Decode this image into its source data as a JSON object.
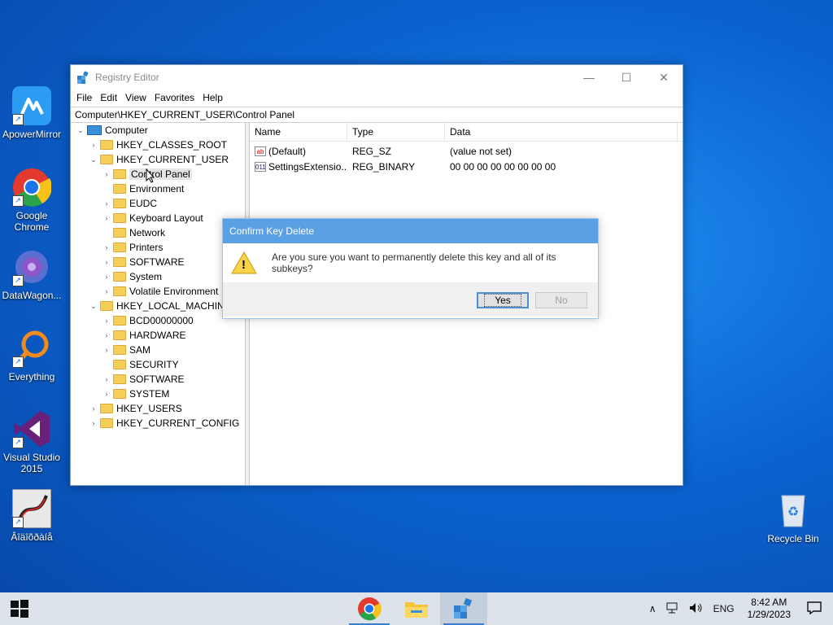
{
  "desktop": {
    "icons": [
      {
        "label": "ApowerMirror"
      },
      {
        "label": "Google\nChrome"
      },
      {
        "label": "DataWagon..."
      },
      {
        "label": "Everything"
      },
      {
        "label": "Visual Studio\n2015"
      },
      {
        "label": "Âîäîõðàíå"
      },
      {
        "label": "Recycle Bin"
      }
    ]
  },
  "window": {
    "title": "Registry Editor",
    "controls": {
      "minimize": "—",
      "maximize": "☐",
      "close": "✕"
    },
    "menu": [
      "File",
      "Edit",
      "View",
      "Favorites",
      "Help"
    ],
    "address": "Computer\\HKEY_CURRENT_USER\\Control Panel",
    "tree": [
      {
        "label": "Computer",
        "arrow": "⌄"
      },
      {
        "label": "HKEY_CLASSES_ROOT",
        "arrow": "›"
      },
      {
        "label": "HKEY_CURRENT_USER",
        "arrow": "⌄"
      },
      {
        "label": "Control Panel",
        "arrow": "›"
      },
      {
        "label": "Environment",
        "arrow": ""
      },
      {
        "label": "EUDC",
        "arrow": "›"
      },
      {
        "label": "Keyboard Layout",
        "arrow": "›"
      },
      {
        "label": "Network",
        "arrow": ""
      },
      {
        "label": "Printers",
        "arrow": "›"
      },
      {
        "label": "SOFTWARE",
        "arrow": "›"
      },
      {
        "label": "System",
        "arrow": "›"
      },
      {
        "label": "Volatile Environment",
        "arrow": "›"
      },
      {
        "label": "HKEY_LOCAL_MACHINE",
        "arrow": "⌄"
      },
      {
        "label": "BCD00000000",
        "arrow": "›"
      },
      {
        "label": "HARDWARE",
        "arrow": "›"
      },
      {
        "label": "SAM",
        "arrow": "›"
      },
      {
        "label": "SECURITY",
        "arrow": ""
      },
      {
        "label": "SOFTWARE",
        "arrow": "›"
      },
      {
        "label": "SYSTEM",
        "arrow": "›"
      },
      {
        "label": "HKEY_USERS",
        "arrow": "›"
      },
      {
        "label": "HKEY_CURRENT_CONFIG",
        "arrow": "›"
      }
    ],
    "columns": [
      "Name",
      "Type",
      "Data"
    ],
    "values": [
      {
        "icon": "ab",
        "name": "(Default)",
        "type": "REG_SZ",
        "data": "(value not set)"
      },
      {
        "icon": "011",
        "name": "SettingsExtensio...",
        "type": "REG_BINARY",
        "data": "00 00 00 00 00 00 00 00"
      }
    ]
  },
  "dialog": {
    "title": "Confirm Key Delete",
    "message": "Are you sure you want to permanently delete this key and all of its subkeys?",
    "yes": "Yes",
    "no": "No",
    "warn_glyph": "!"
  },
  "taskbar": {
    "language": "ENG",
    "time": "8:42 AM",
    "date": "1/29/2023",
    "tray_chevron": "∧"
  },
  "colors": {
    "accent": "#5aa0e4",
    "desktop": "#0b63d0",
    "folder": "#f5cf5a"
  }
}
